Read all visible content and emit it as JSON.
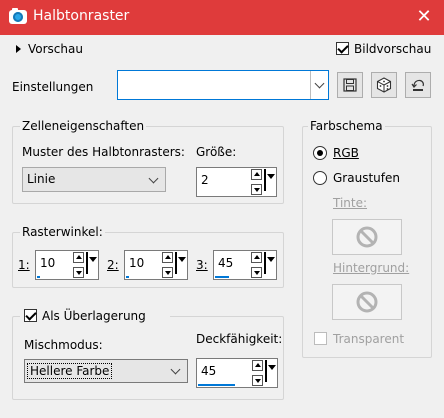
{
  "window": {
    "title": "Halbtonraster",
    "close_label": "✕"
  },
  "preview": {
    "label": "Vorschau",
    "bildvorschau_label": "Bildvorschau",
    "bildvorschau_checked": true
  },
  "settings": {
    "label": "Einstellungen",
    "value": ""
  },
  "cell_props": {
    "legend": "Zelleneigenschaften",
    "pattern_label": "Muster des Halbtonrasters:",
    "pattern_value": "Linie",
    "size_label": "Größe:",
    "size_value": "2"
  },
  "screen_angle": {
    "legend": "Rasterwinkel:",
    "ch1_label": "1:",
    "ch1_value": "10",
    "ch2_label": "2:",
    "ch2_value": "10",
    "ch3_label": "3:",
    "ch3_value": "45"
  },
  "overlay": {
    "label": "Als Überlagerung",
    "checked": true,
    "blend_label": "Mischmodus:",
    "blend_value": "Hellere Farbe",
    "opacity_label": "Deckfähigkeit:",
    "opacity_value": "45"
  },
  "color_scheme": {
    "legend": "Farbschema",
    "rgb_label": "RGB",
    "rgb_selected": true,
    "gray_label": "Graustufen",
    "ink_label": "Tinte:",
    "background_label": "Hintergrund:",
    "transparent_label": "Transparent"
  },
  "colors": {
    "titlebar": "#df3b3b",
    "accent": "#0078d7"
  }
}
